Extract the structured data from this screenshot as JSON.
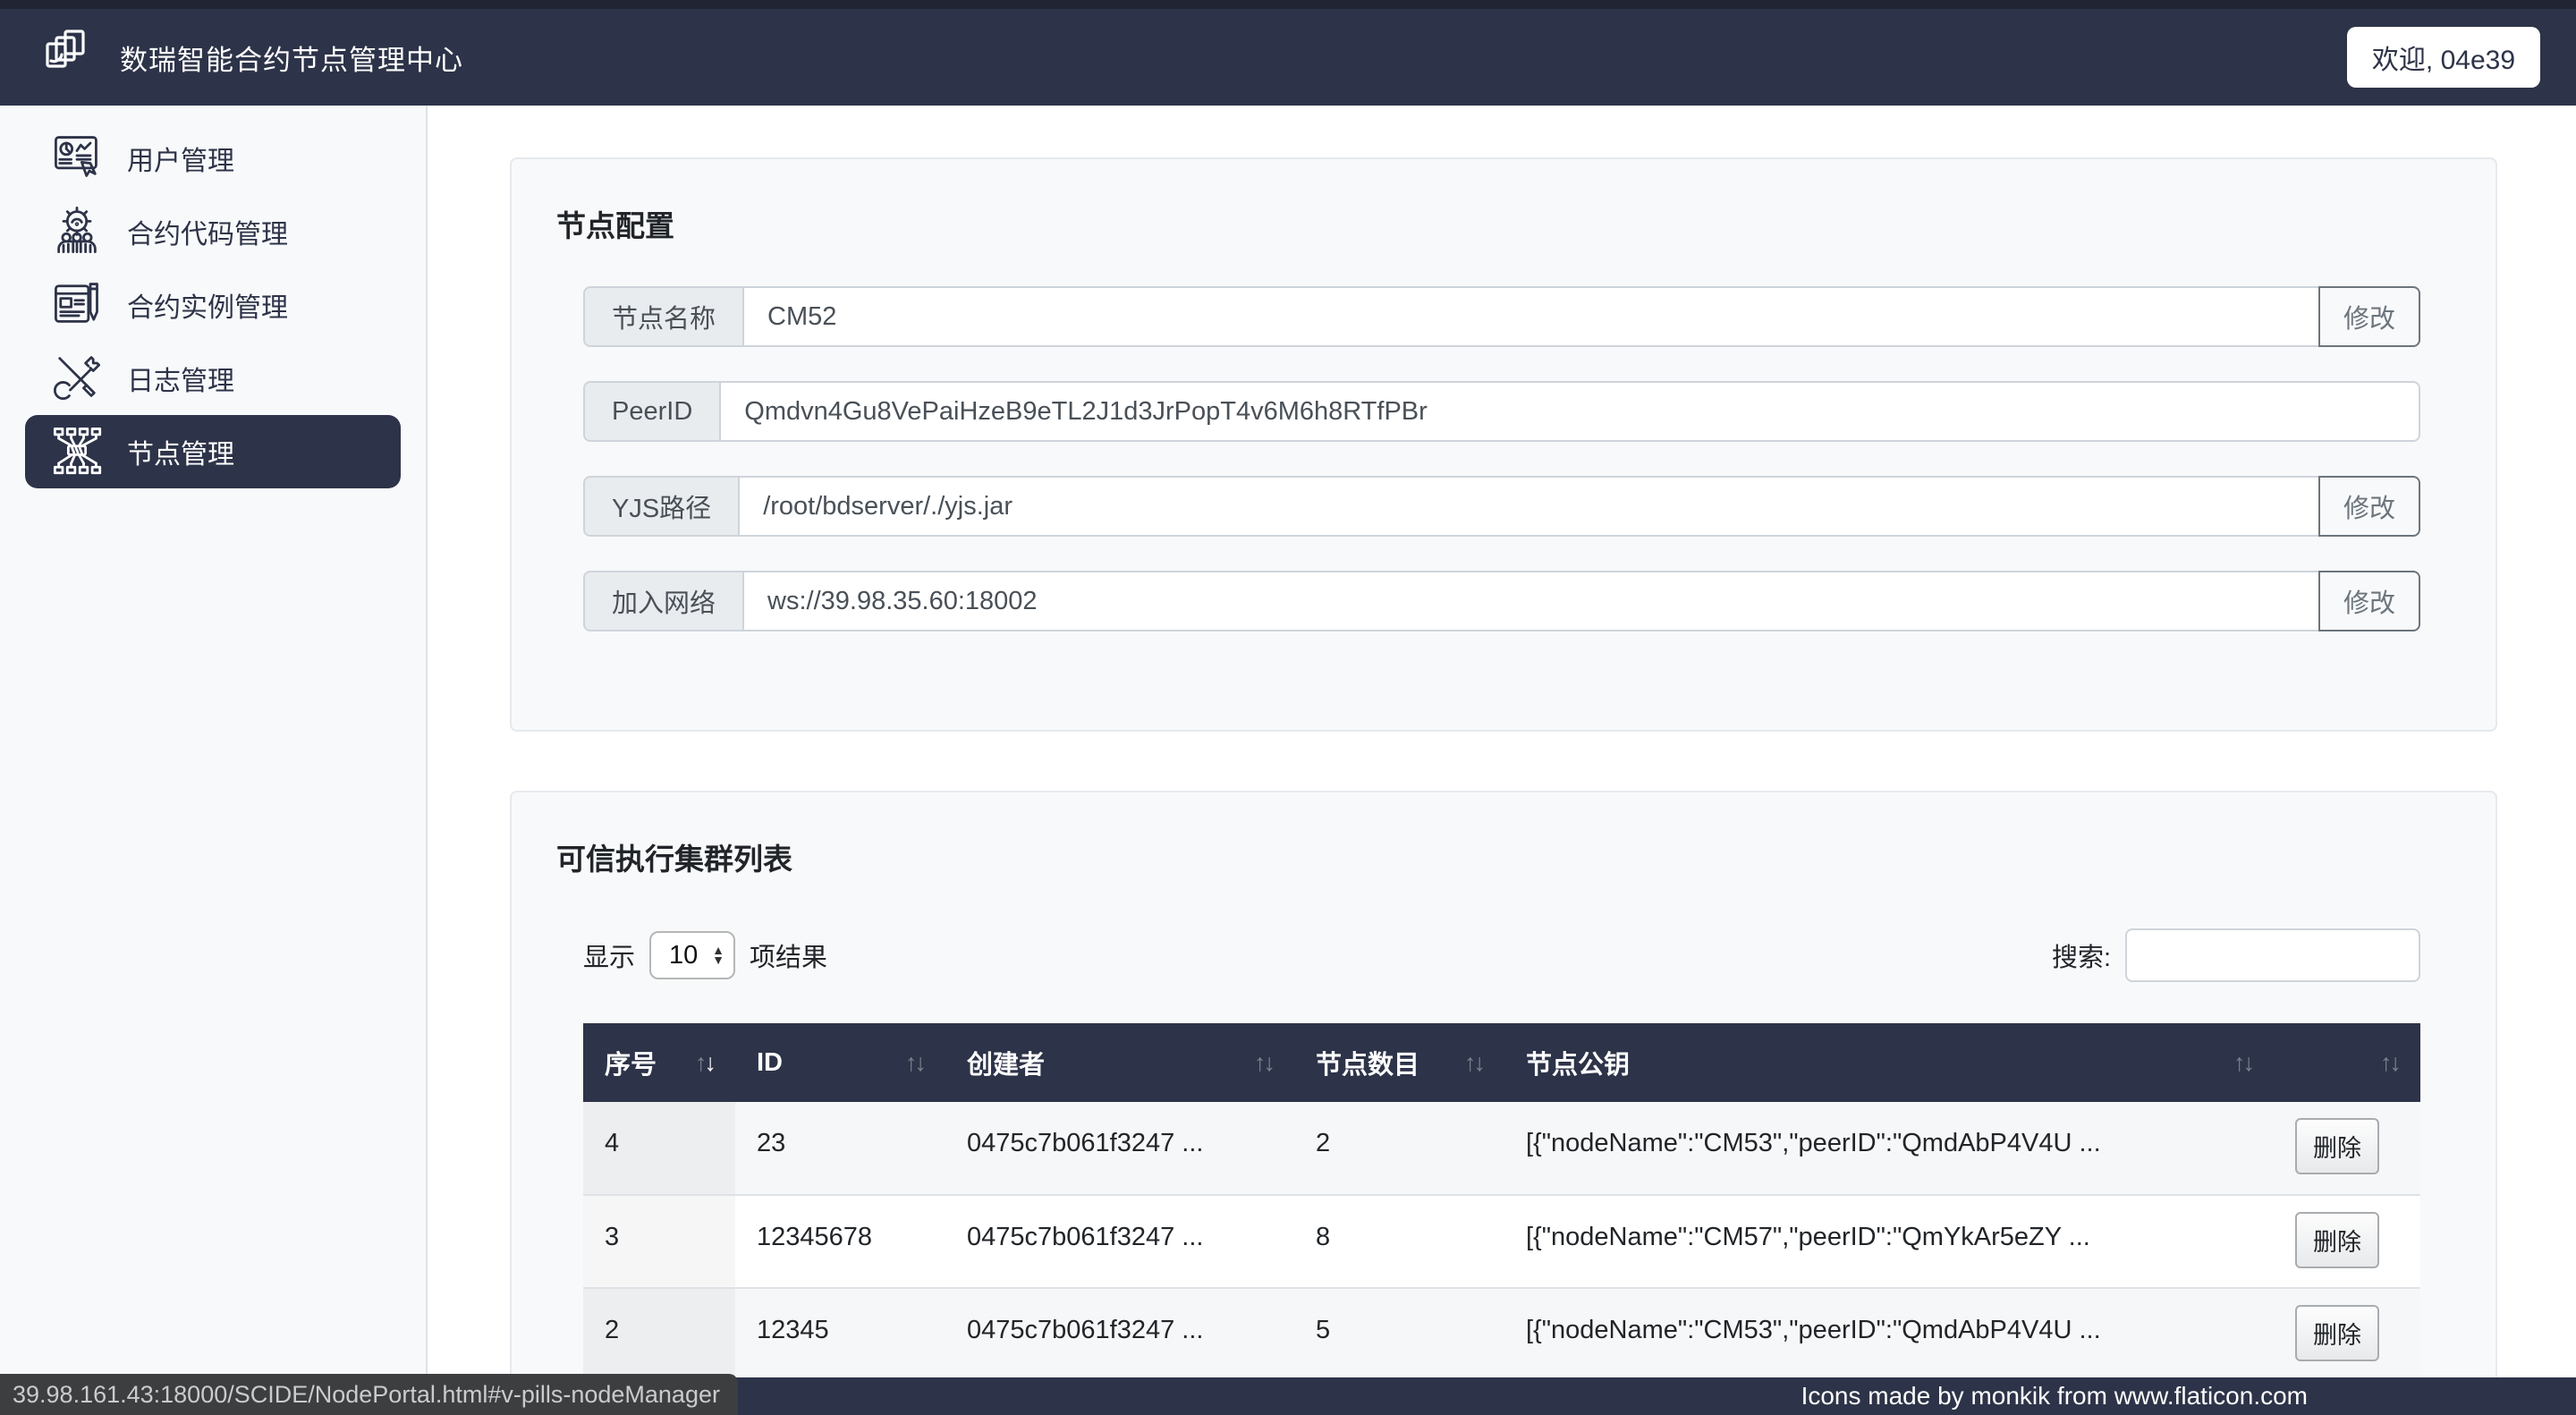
{
  "navbar": {
    "title": "数瑞智能合约节点管理中心",
    "welcome": "欢迎, 04e39"
  },
  "sidebar": {
    "items": [
      {
        "label": "用户管理"
      },
      {
        "label": "合约代码管理"
      },
      {
        "label": "合约实例管理"
      },
      {
        "label": "日志管理"
      },
      {
        "label": "节点管理"
      }
    ]
  },
  "node_config": {
    "title": "节点配置",
    "fields": [
      {
        "label": "节点名称",
        "value": "CM52",
        "action": "修改"
      },
      {
        "label": "PeerID",
        "value": "Qmdvn4Gu8VePaiHzeB9eTL2J1d3JrPopT4v6M6h8RTfPBr",
        "action": ""
      },
      {
        "label": "YJS路径",
        "value": "/root/bdserver/./yjs.jar",
        "action": "修改"
      },
      {
        "label": "加入网络",
        "value": "ws://39.98.35.60:18002",
        "action": "修改"
      }
    ]
  },
  "cluster": {
    "title": "可信执行集群列表",
    "show_label": "显示",
    "page_size": "10",
    "results_label": "项结果",
    "search_label": "搜索:",
    "table": {
      "headers": [
        {
          "label": "序号",
          "sort": "desc"
        },
        {
          "label": "ID",
          "sort": "none"
        },
        {
          "label": "创建者",
          "sort": "none"
        },
        {
          "label": "节点数目",
          "sort": "none"
        },
        {
          "label": "节点公钥",
          "sort": "none"
        },
        {
          "label": "",
          "sort": "none"
        }
      ],
      "rows": [
        {
          "seq": "4",
          "id": "23",
          "creator": "0475c7b061f3247 ...",
          "node_count": "2",
          "pubkey": "[{\"nodeName\":\"CM53\",\"peerID\":\"QmdAbP4V4U ...",
          "action": "删除"
        },
        {
          "seq": "3",
          "id": "12345678",
          "creator": "0475c7b061f3247 ...",
          "node_count": "8",
          "pubkey": "[{\"nodeName\":\"CM57\",\"peerID\":\"QmYkAr5eZY ...",
          "action": "删除"
        },
        {
          "seq": "2",
          "id": "12345",
          "creator": "0475c7b061f3247 ...",
          "node_count": "5",
          "pubkey": "[{\"nodeName\":\"CM53\",\"peerID\":\"QmdAbP4V4U ...",
          "action": "删除"
        }
      ]
    }
  },
  "status_bar": {
    "url": "39.98.161.43:18000/SCIDE/NodePortal.html#v-pills-nodeManager"
  },
  "footer": {
    "credit": "Icons made by monkik from www.flaticon.com"
  },
  "icons": {
    "sort_asc": "↑",
    "sort_desc": "↓",
    "stepper_up": "▲",
    "stepper_down": "▼"
  },
  "colors": {
    "navy": "#2d3348",
    "sidebar_bg": "#f8f9fa",
    "card_bg": "#f8f9fa",
    "input_border": "#ced4da",
    "muted": "#6c757d",
    "stripe": "#f6f7f8"
  }
}
